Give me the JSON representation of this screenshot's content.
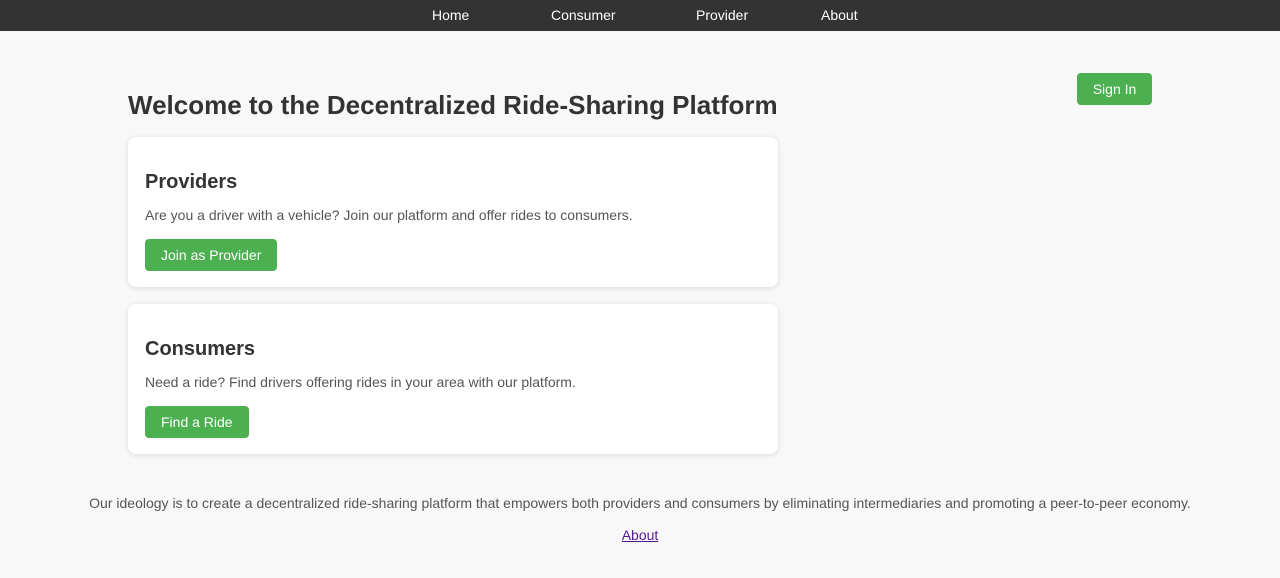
{
  "nav": {
    "items": [
      {
        "label": "Home"
      },
      {
        "label": "Consumer"
      },
      {
        "label": "Provider"
      },
      {
        "label": "About"
      }
    ]
  },
  "header": {
    "signin_label": "Sign In",
    "title": "Welcome to the Decentralized Ride-Sharing Platform"
  },
  "cards": [
    {
      "heading": "Providers",
      "text": "Are you a driver with a vehicle? Join our platform and offer rides to consumers.",
      "button": "Join as Provider"
    },
    {
      "heading": "Consumers",
      "text": "Need a ride? Find drivers offering rides in your area with our platform.",
      "button": "Find a Ride"
    }
  ],
  "footer": {
    "ideology": "Our ideology is to create a decentralized ride-sharing platform that empowers both providers and consumers by eliminating intermediaries and promoting a peer-to-peer economy.",
    "about_link": "About"
  },
  "colors": {
    "nav_bg": "#333333",
    "accent": "#4caf50",
    "page_bg": "#f8f8f8",
    "link_visited": "#551a8b"
  }
}
